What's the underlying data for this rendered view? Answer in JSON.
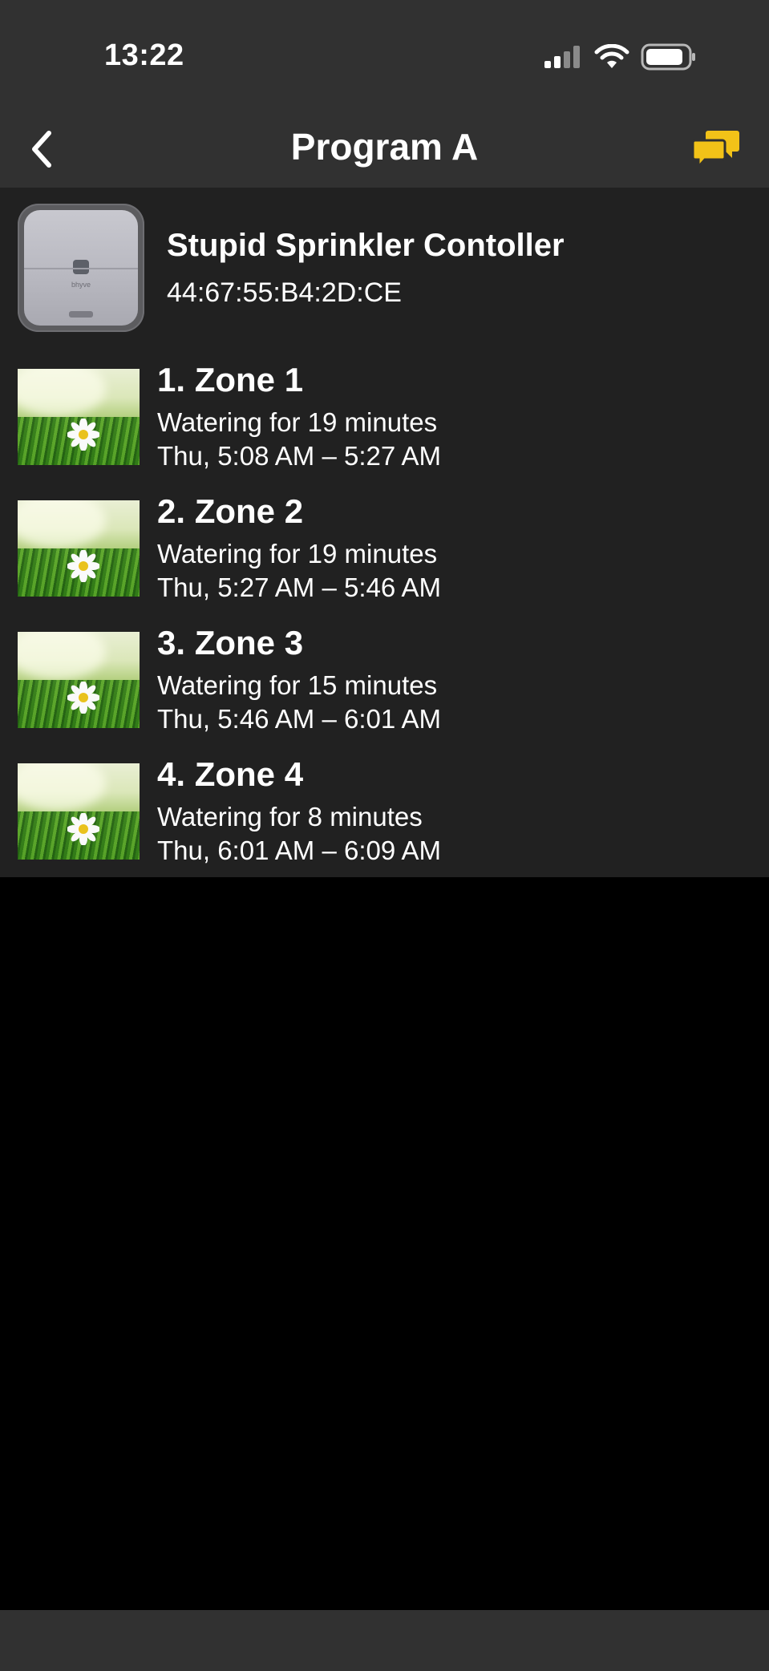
{
  "status_bar": {
    "time": "13:22"
  },
  "nav": {
    "title": "Program A"
  },
  "device": {
    "name": "Stupid Sprinkler Contoller",
    "mac": "44:67:55:B4:2D:CE",
    "brand_text": "bhyve"
  },
  "zones": [
    {
      "title": "1. Zone 1",
      "duration": "Watering for 19 minutes",
      "time": "Thu, 5:08 AM – 5:27 AM"
    },
    {
      "title": "2. Zone 2",
      "duration": "Watering for 19 minutes",
      "time": "Thu, 5:27 AM – 5:46 AM"
    },
    {
      "title": "3. Zone 3",
      "duration": "Watering for 15 minutes",
      "time": "Thu, 5:46 AM – 6:01 AM"
    },
    {
      "title": "4. Zone 4",
      "duration": "Watering for 8 minutes",
      "time": "Thu, 6:01 AM – 6:09 AM"
    }
  ],
  "colors": {
    "accent": "#f2c218",
    "bar": "#313131",
    "content_bg": "#212121",
    "page_bg": "#000000"
  },
  "icons": {
    "back": "chevron-left-icon",
    "chat": "chat-bubbles-icon",
    "signal": "cellular-signal-icon",
    "wifi": "wifi-icon",
    "battery": "battery-icon"
  }
}
